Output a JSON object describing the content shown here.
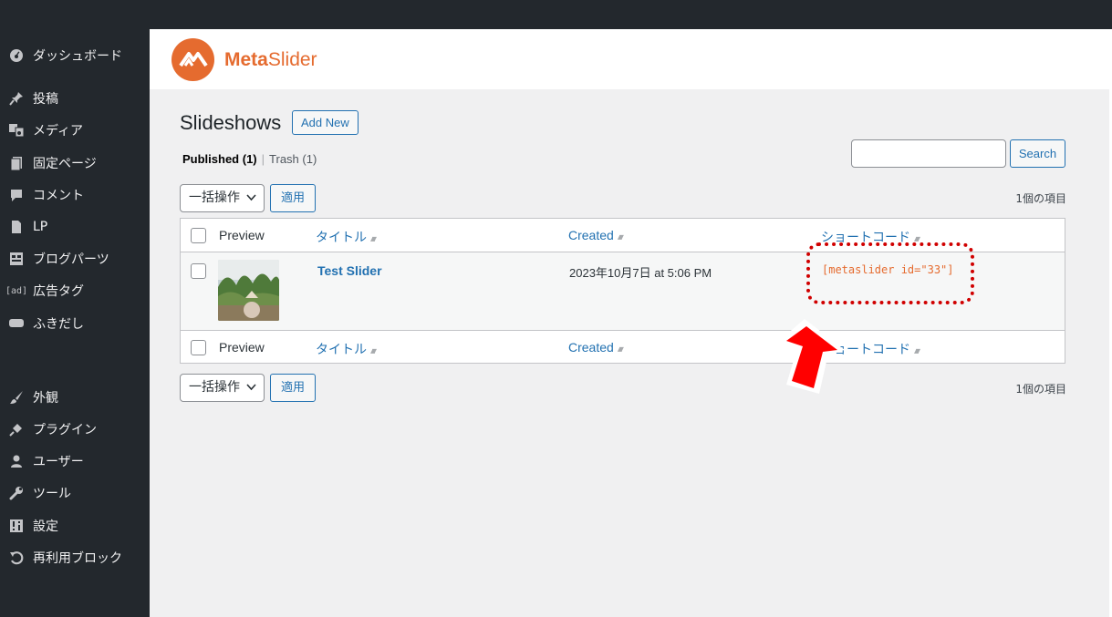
{
  "sidebar": {
    "items": [
      {
        "label": "ダッシュボード",
        "icon": "dashboard-icon",
        "glyph": "⊛"
      },
      {
        "label": "投稿",
        "icon": "pin-icon",
        "glyph": "📌"
      },
      {
        "label": "メディア",
        "icon": "media-icon",
        "glyph": "▣"
      },
      {
        "label": "固定ページ",
        "icon": "page-icon",
        "glyph": "▤"
      },
      {
        "label": "コメント",
        "icon": "comment-icon",
        "glyph": "■"
      },
      {
        "label": "LP",
        "icon": "document-icon",
        "glyph": "▮"
      },
      {
        "label": "ブログパーツ",
        "icon": "layout-icon",
        "glyph": "▦"
      },
      {
        "label": "広告タグ",
        "icon": "ad-icon",
        "glyph": "[ad]"
      },
      {
        "label": "ふきだし",
        "icon": "speech-bubble-icon",
        "glyph": "▬"
      },
      {
        "label": "外観",
        "icon": "brush-icon",
        "glyph": "✎"
      },
      {
        "label": "プラグイン",
        "icon": "plugin-icon",
        "glyph": "⚡"
      },
      {
        "label": "ユーザー",
        "icon": "user-icon",
        "glyph": "●"
      },
      {
        "label": "ツール",
        "icon": "wrench-icon",
        "glyph": "🔧"
      },
      {
        "label": "設定",
        "icon": "settings-icon",
        "glyph": "⊞"
      },
      {
        "label": "再利用ブロック",
        "icon": "undo-icon",
        "glyph": "↺"
      }
    ]
  },
  "brand": {
    "name_bold": "Meta",
    "name_light": "Slider",
    "logo_color": "#e56b2f"
  },
  "page": {
    "title": "Slideshows",
    "add_new": "Add New"
  },
  "filters": {
    "published": "Published",
    "published_count": "(1)",
    "trash": "Trash (1)",
    "separator": "|"
  },
  "search": {
    "button": "Search",
    "value": ""
  },
  "bulk": {
    "label": "一括操作",
    "apply": "適用",
    "count": "1個の項目"
  },
  "table": {
    "columns": [
      "Preview",
      "タイトル",
      "Created",
      "ショートコード"
    ],
    "rows": [
      {
        "title": "Test Slider",
        "created": "2023年10月7日 at 5:06 PM",
        "shortcode": "[metaslider id=\"33\"]"
      }
    ]
  },
  "colors": {
    "accent": "#2271b1",
    "shortcode": "#e56b2f",
    "highlight": "#d00000",
    "arrow": "#ff0000"
  }
}
